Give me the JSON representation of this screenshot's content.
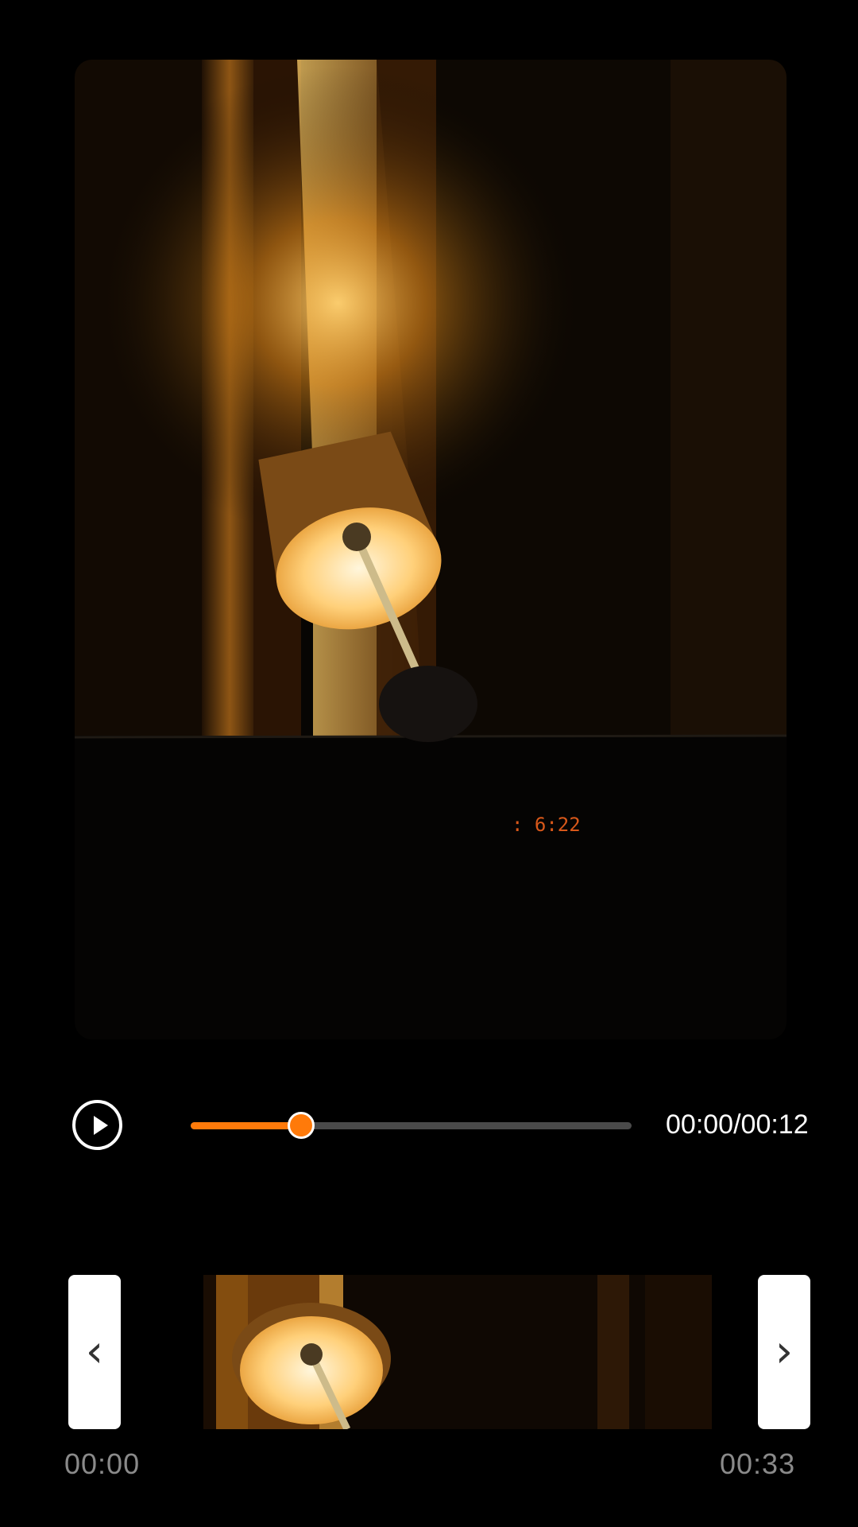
{
  "player": {
    "progress_fraction": 0.25,
    "time_readout": "00:00/00:12",
    "play_icon": "play-circle-icon",
    "accent_color": "#ff7a0a"
  },
  "preview": {
    "clock_text": ": 6:22"
  },
  "trim": {
    "start_time": "00:00",
    "end_time": "00:33",
    "left_handle_icon": "chevron-left-icon",
    "right_handle_icon": "chevron-right-icon",
    "left_glyph": "‹",
    "right_glyph": "›"
  }
}
